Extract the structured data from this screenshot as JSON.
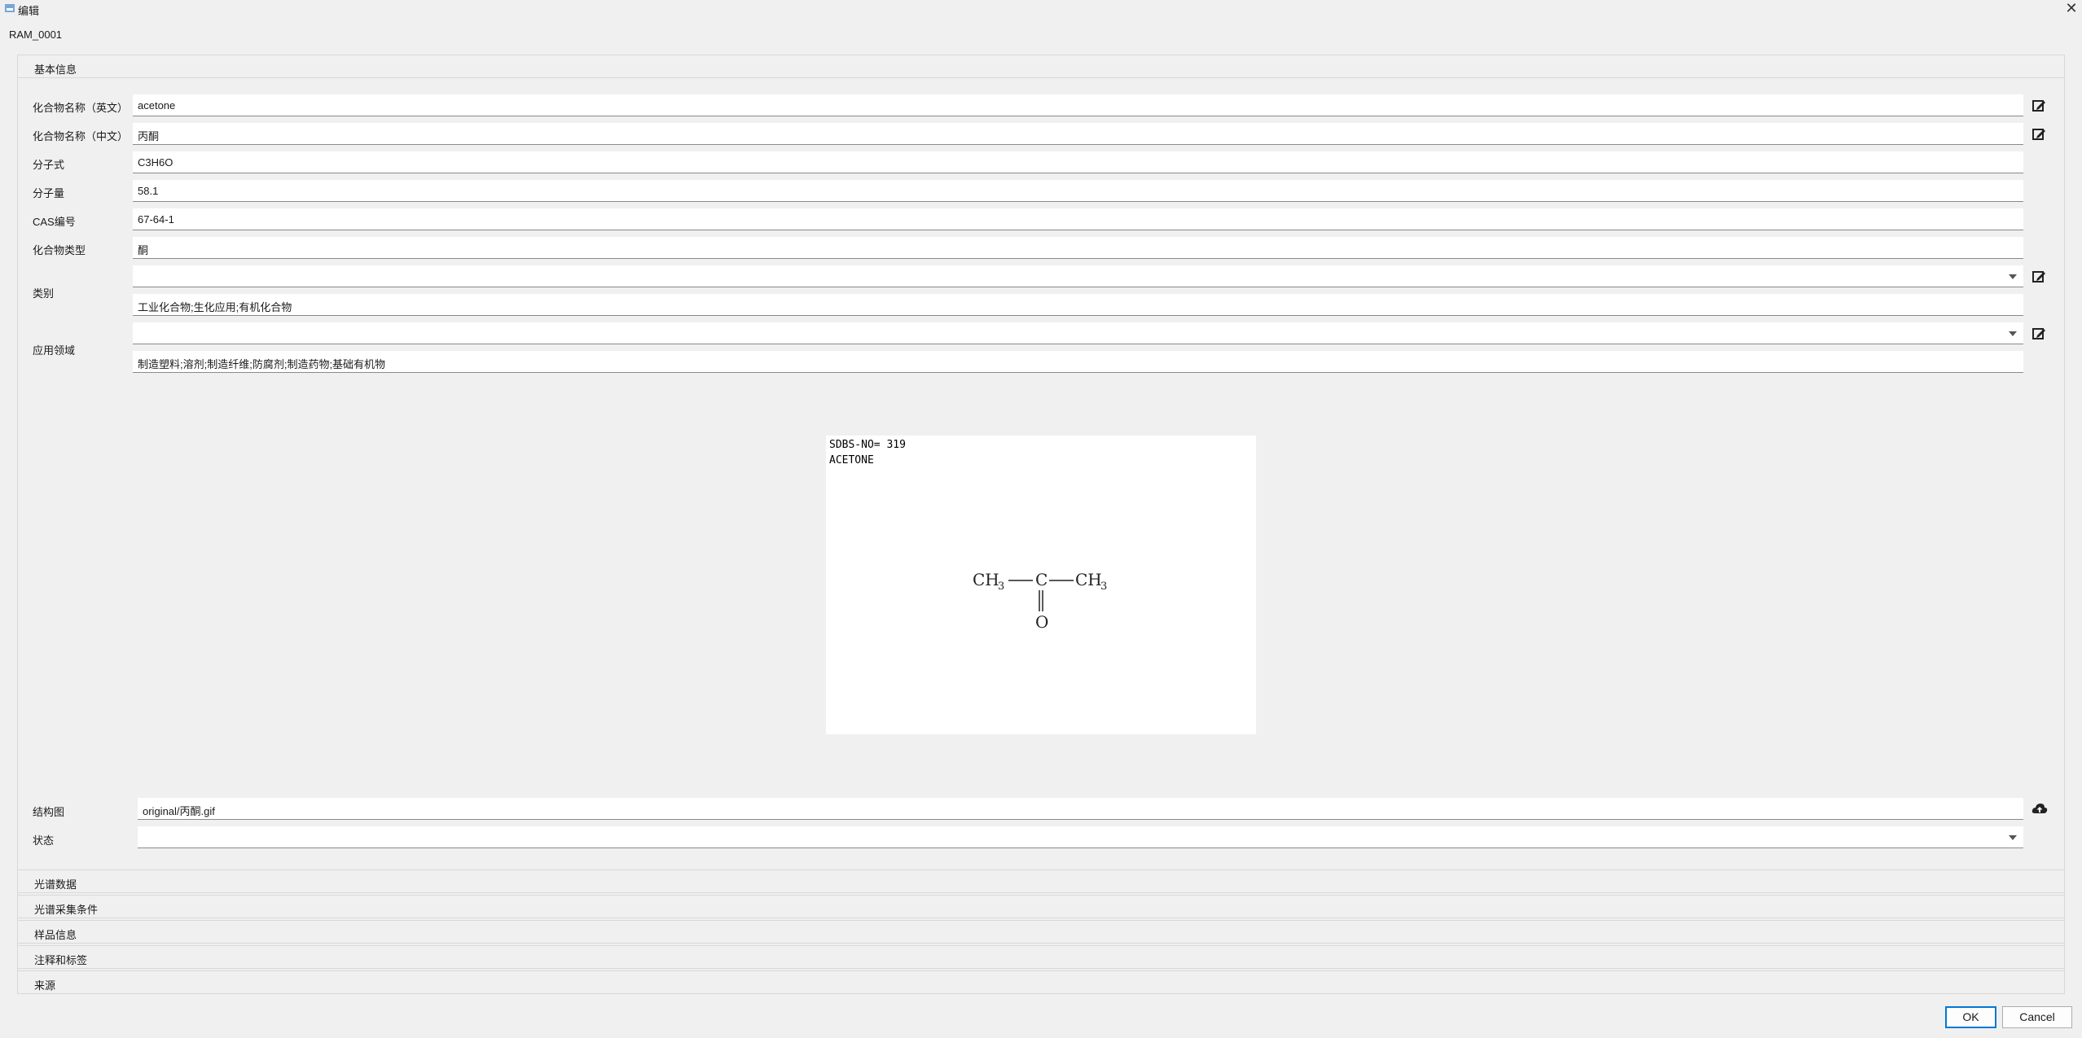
{
  "window": {
    "title": "编辑",
    "record_id": "RAM_0001",
    "close_glyph": "✕"
  },
  "sections": {
    "basic": "基本信息",
    "collapsed": [
      "光谱数据",
      "光谱采集条件",
      "样品信息",
      "注释和标签",
      "来源"
    ]
  },
  "fields": {
    "name_en": {
      "label": "化合物名称（英文）",
      "value": "acetone"
    },
    "name_cn": {
      "label": "化合物名称（中文）",
      "value": "丙酮"
    },
    "formula": {
      "label": "分子式",
      "value": "C3H6O"
    },
    "mol_weight": {
      "label": "分子量",
      "value": "58.1"
    },
    "cas": {
      "label": "CAS编号",
      "value": "67-64-1"
    },
    "compound_type": {
      "label": "化合物类型",
      "value": "酮"
    },
    "category": {
      "label": "类别",
      "selected": "",
      "value": "工业化合物;生化应用;有机化合物"
    },
    "application": {
      "label": "应用领域",
      "selected": "",
      "value": "制造塑料;溶剂;制造纤维;防腐剂;制造药物;基础有机物"
    },
    "structure_image": {
      "label": "结构图",
      "value": "original/丙酮.gif"
    },
    "state": {
      "label": "状态",
      "selected": ""
    }
  },
  "structure": {
    "header_line1": "SDBS-NO=  319",
    "header_line2": "ACETONE",
    "left_group": "CH",
    "right_group": "CH",
    "subscript": "3",
    "center_atom": "C",
    "bottom_atom": "O"
  },
  "buttons": {
    "ok": "OK",
    "cancel": "Cancel"
  },
  "icons": {
    "edit": "edit-icon",
    "upload": "cloud-upload-icon",
    "dropdown": "chevron-down-icon"
  }
}
